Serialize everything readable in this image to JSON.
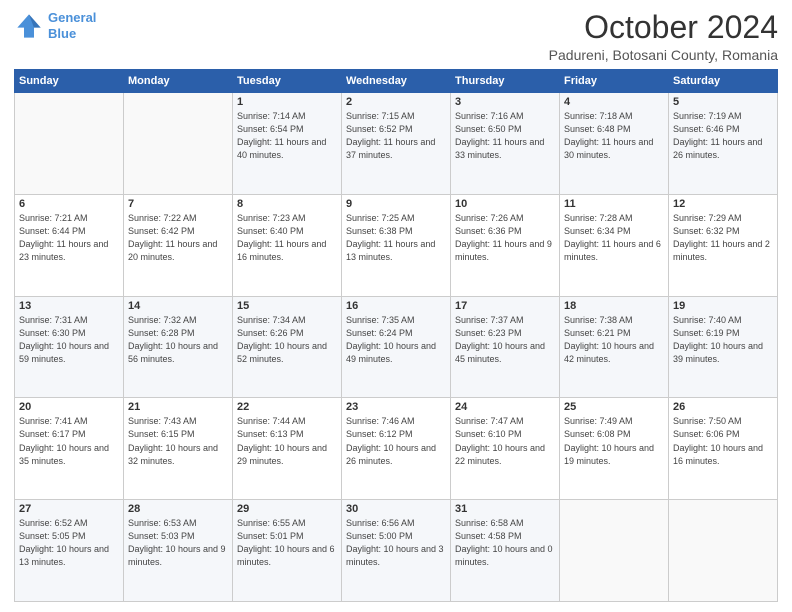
{
  "header": {
    "logo_line1": "General",
    "logo_line2": "Blue",
    "title": "October 2024",
    "subtitle": "Padureni, Botosani County, Romania"
  },
  "weekdays": [
    "Sunday",
    "Monday",
    "Tuesday",
    "Wednesday",
    "Thursday",
    "Friday",
    "Saturday"
  ],
  "weeks": [
    [
      {
        "day": "",
        "info": ""
      },
      {
        "day": "",
        "info": ""
      },
      {
        "day": "1",
        "info": "Sunrise: 7:14 AM\nSunset: 6:54 PM\nDaylight: 11 hours and 40 minutes."
      },
      {
        "day": "2",
        "info": "Sunrise: 7:15 AM\nSunset: 6:52 PM\nDaylight: 11 hours and 37 minutes."
      },
      {
        "day": "3",
        "info": "Sunrise: 7:16 AM\nSunset: 6:50 PM\nDaylight: 11 hours and 33 minutes."
      },
      {
        "day": "4",
        "info": "Sunrise: 7:18 AM\nSunset: 6:48 PM\nDaylight: 11 hours and 30 minutes."
      },
      {
        "day": "5",
        "info": "Sunrise: 7:19 AM\nSunset: 6:46 PM\nDaylight: 11 hours and 26 minutes."
      }
    ],
    [
      {
        "day": "6",
        "info": "Sunrise: 7:21 AM\nSunset: 6:44 PM\nDaylight: 11 hours and 23 minutes."
      },
      {
        "day": "7",
        "info": "Sunrise: 7:22 AM\nSunset: 6:42 PM\nDaylight: 11 hours and 20 minutes."
      },
      {
        "day": "8",
        "info": "Sunrise: 7:23 AM\nSunset: 6:40 PM\nDaylight: 11 hours and 16 minutes."
      },
      {
        "day": "9",
        "info": "Sunrise: 7:25 AM\nSunset: 6:38 PM\nDaylight: 11 hours and 13 minutes."
      },
      {
        "day": "10",
        "info": "Sunrise: 7:26 AM\nSunset: 6:36 PM\nDaylight: 11 hours and 9 minutes."
      },
      {
        "day": "11",
        "info": "Sunrise: 7:28 AM\nSunset: 6:34 PM\nDaylight: 11 hours and 6 minutes."
      },
      {
        "day": "12",
        "info": "Sunrise: 7:29 AM\nSunset: 6:32 PM\nDaylight: 11 hours and 2 minutes."
      }
    ],
    [
      {
        "day": "13",
        "info": "Sunrise: 7:31 AM\nSunset: 6:30 PM\nDaylight: 10 hours and 59 minutes."
      },
      {
        "day": "14",
        "info": "Sunrise: 7:32 AM\nSunset: 6:28 PM\nDaylight: 10 hours and 56 minutes."
      },
      {
        "day": "15",
        "info": "Sunrise: 7:34 AM\nSunset: 6:26 PM\nDaylight: 10 hours and 52 minutes."
      },
      {
        "day": "16",
        "info": "Sunrise: 7:35 AM\nSunset: 6:24 PM\nDaylight: 10 hours and 49 minutes."
      },
      {
        "day": "17",
        "info": "Sunrise: 7:37 AM\nSunset: 6:23 PM\nDaylight: 10 hours and 45 minutes."
      },
      {
        "day": "18",
        "info": "Sunrise: 7:38 AM\nSunset: 6:21 PM\nDaylight: 10 hours and 42 minutes."
      },
      {
        "day": "19",
        "info": "Sunrise: 7:40 AM\nSunset: 6:19 PM\nDaylight: 10 hours and 39 minutes."
      }
    ],
    [
      {
        "day": "20",
        "info": "Sunrise: 7:41 AM\nSunset: 6:17 PM\nDaylight: 10 hours and 35 minutes."
      },
      {
        "day": "21",
        "info": "Sunrise: 7:43 AM\nSunset: 6:15 PM\nDaylight: 10 hours and 32 minutes."
      },
      {
        "day": "22",
        "info": "Sunrise: 7:44 AM\nSunset: 6:13 PM\nDaylight: 10 hours and 29 minutes."
      },
      {
        "day": "23",
        "info": "Sunrise: 7:46 AM\nSunset: 6:12 PM\nDaylight: 10 hours and 26 minutes."
      },
      {
        "day": "24",
        "info": "Sunrise: 7:47 AM\nSunset: 6:10 PM\nDaylight: 10 hours and 22 minutes."
      },
      {
        "day": "25",
        "info": "Sunrise: 7:49 AM\nSunset: 6:08 PM\nDaylight: 10 hours and 19 minutes."
      },
      {
        "day": "26",
        "info": "Sunrise: 7:50 AM\nSunset: 6:06 PM\nDaylight: 10 hours and 16 minutes."
      }
    ],
    [
      {
        "day": "27",
        "info": "Sunrise: 6:52 AM\nSunset: 5:05 PM\nDaylight: 10 hours and 13 minutes."
      },
      {
        "day": "28",
        "info": "Sunrise: 6:53 AM\nSunset: 5:03 PM\nDaylight: 10 hours and 9 minutes."
      },
      {
        "day": "29",
        "info": "Sunrise: 6:55 AM\nSunset: 5:01 PM\nDaylight: 10 hours and 6 minutes."
      },
      {
        "day": "30",
        "info": "Sunrise: 6:56 AM\nSunset: 5:00 PM\nDaylight: 10 hours and 3 minutes."
      },
      {
        "day": "31",
        "info": "Sunrise: 6:58 AM\nSunset: 4:58 PM\nDaylight: 10 hours and 0 minutes."
      },
      {
        "day": "",
        "info": ""
      },
      {
        "day": "",
        "info": ""
      }
    ]
  ]
}
